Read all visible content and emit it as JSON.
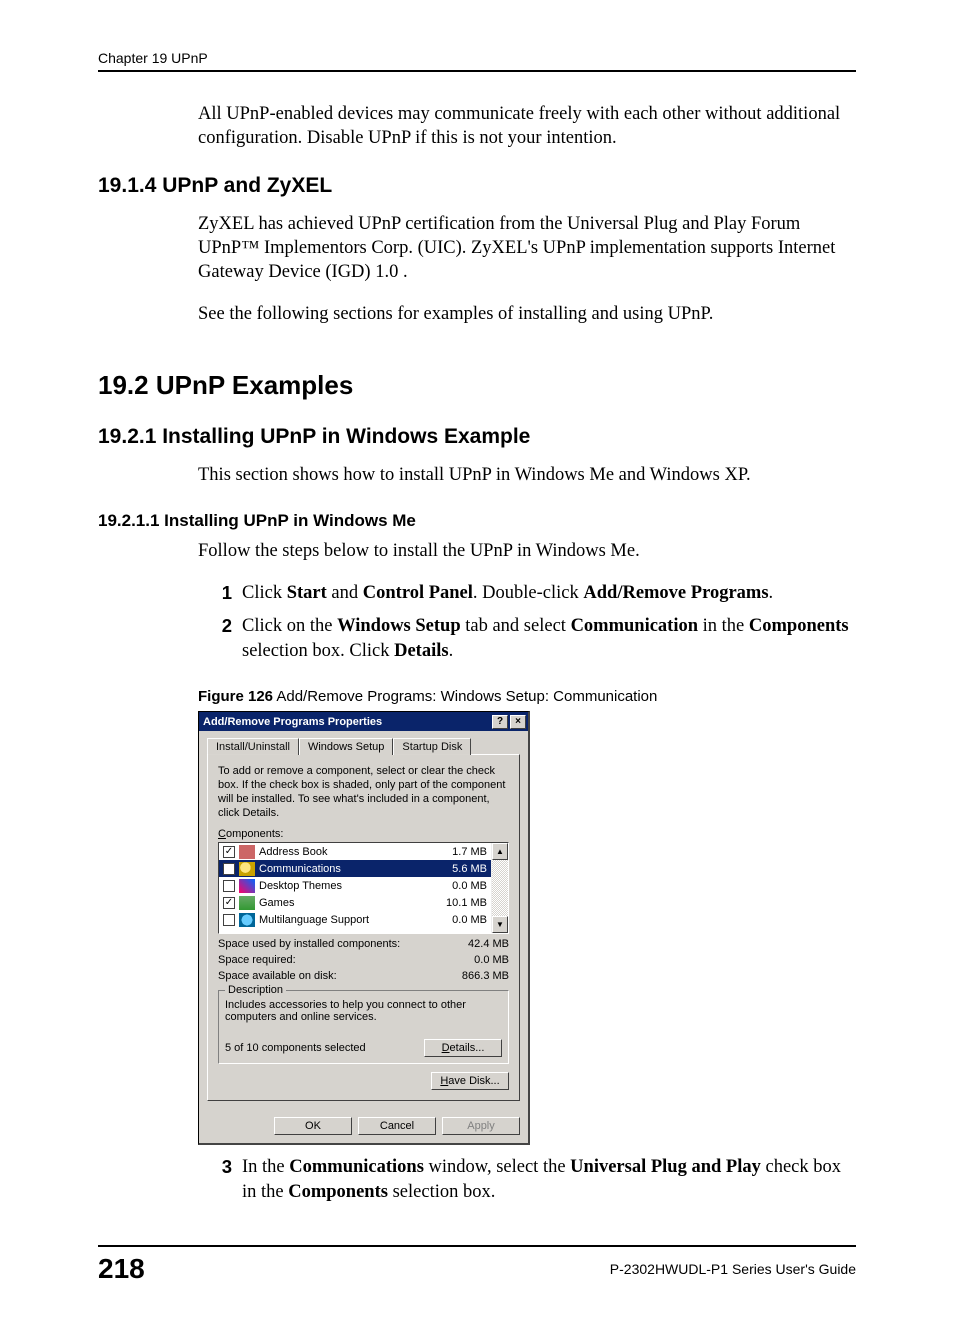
{
  "header": "Chapter 19 UPnP",
  "intro_text": "All UPnP-enabled devices may communicate freely with each other without additional configuration. Disable UPnP if this is not your intention.",
  "s1": {
    "heading": "19.1.4  UPnP and ZyXEL",
    "p1": "ZyXEL has achieved UPnP certification from the Universal Plug and Play Forum UPnP™ Implementors Corp. (UIC). ZyXEL's UPnP implementation supports Internet Gateway Device (IGD) 1.0 .",
    "p2": "See the following sections for examples of installing and using UPnP."
  },
  "s2": {
    "heading": "19.2  UPnP Examples",
    "sub1": {
      "heading": "19.2.1  Installing UPnP in Windows Example",
      "p1": "This section shows how to install UPnP in Windows Me and Windows XP.",
      "sub": {
        "heading": "19.2.1.1  Installing UPnP in Windows Me",
        "p1": "Follow the steps below to install the UPnP in Windows Me.",
        "steps": {
          "n1": "1",
          "t1a": "Click ",
          "t1b": "Start",
          "t1c": " and ",
          "t1d": "Control Panel",
          "t1e": ". Double-click ",
          "t1f": "Add/Remove Programs",
          "t1g": ".",
          "n2": "2",
          "t2a": "Click on the ",
          "t2b": "Windows Setup",
          "t2c": " tab and select ",
          "t2d": "Communication",
          "t2e": " in the ",
          "t2f": "Components",
          "t2g": " selection box. Click ",
          "t2h": "Details",
          "t2i": ".",
          "n3": "3",
          "t3a": "In the ",
          "t3b": "Communications",
          "t3c": " window, select the ",
          "t3d": "Universal Plug and Play",
          "t3e": " check box in the ",
          "t3f": "Components",
          "t3g": " selection box."
        }
      }
    }
  },
  "figure": {
    "label": "Figure 126",
    "caption": "   Add/Remove Programs: Windows Setup: Communication"
  },
  "dialog": {
    "title": "Add/Remove Programs Properties",
    "help": "?",
    "close": "×",
    "tabs": {
      "t1": "Install/Uninstall",
      "t2": "Windows Setup",
      "t3": "Startup Disk"
    },
    "instructions": "To add or remove a component, select or clear the check box. If the check box is shaded, only part of the component will be installed. To see what's included in a component, click Details.",
    "components_label_pre": "C",
    "components_label_post": "omponents:",
    "rows": [
      {
        "checked": true,
        "name": "Address Book",
        "size": "1.7 MB",
        "sel": false,
        "ico": "ico-book"
      },
      {
        "checked": true,
        "name": "Communications",
        "size": "5.6 MB",
        "sel": true,
        "ico": "ico-comm"
      },
      {
        "checked": false,
        "name": "Desktop Themes",
        "size": "0.0 MB",
        "sel": false,
        "ico": "ico-theme"
      },
      {
        "checked": true,
        "name": "Games",
        "size": "10.1 MB",
        "sel": false,
        "ico": "ico-games"
      },
      {
        "checked": false,
        "name": "Multilanguage Support",
        "size": "0.0 MB",
        "sel": false,
        "ico": "ico-lang"
      }
    ],
    "scroll_up": "▲",
    "scroll_down": "▼",
    "space_used_l": "Space used by installed components:",
    "space_used_v": "42.4 MB",
    "space_req_l": "Space required:",
    "space_req_v": "0.0 MB",
    "space_avail_l": "Space available on disk:",
    "space_avail_v": "866.3 MB",
    "desc_title": "Description",
    "desc_text": "Includes accessories to help you connect to other computers and online services.",
    "selected_text": "5 of 10 components selected",
    "details_pre": "D",
    "details_post": "etails...",
    "havedisk_pre": "H",
    "havedisk_post": "ave Disk...",
    "ok": "OK",
    "cancel": "Cancel",
    "apply": "Apply"
  },
  "footer": {
    "page": "218",
    "guide": "P-2302HWUDL-P1 Series User's Guide"
  }
}
